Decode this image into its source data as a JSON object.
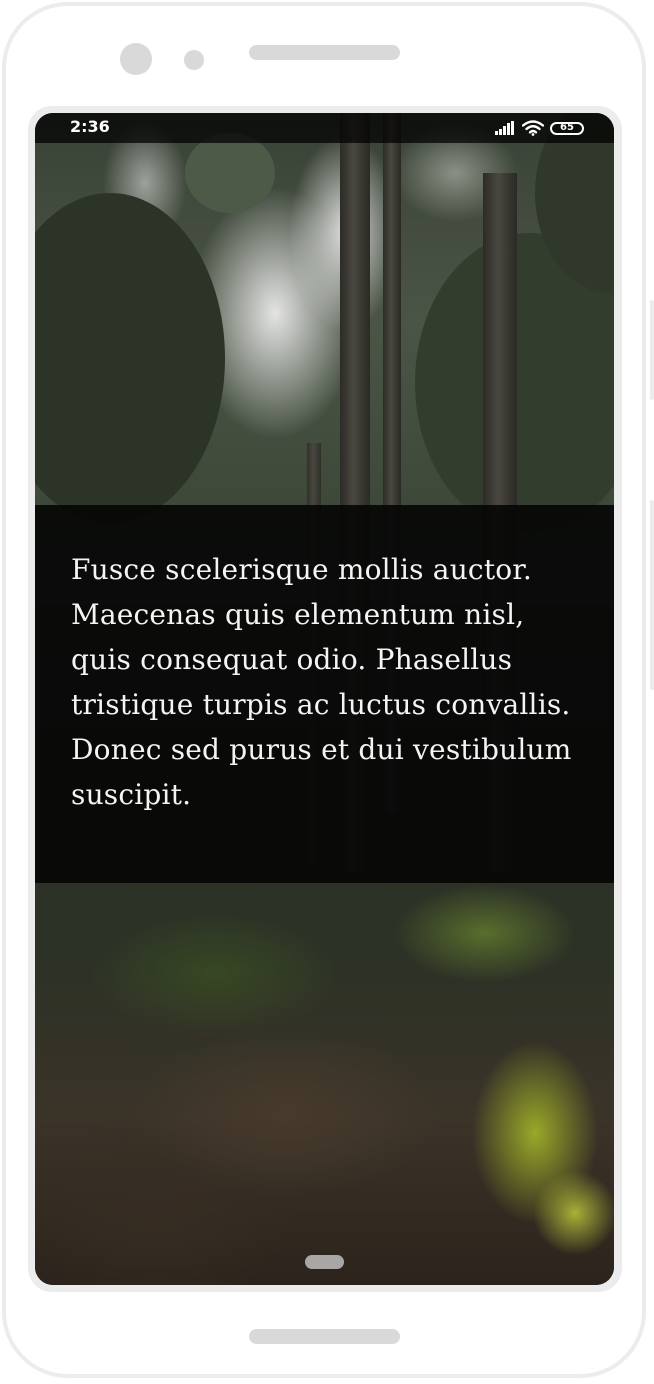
{
  "status_bar": {
    "time": "2:36",
    "battery_level": "65",
    "icons": [
      "signal-icon",
      "wifi-icon",
      "battery-icon"
    ]
  },
  "content": {
    "paragraph": "Fusce scelerisque mollis auctor. Maecenas quis elementum nisl, quis consequat odio. Phasellus tristique turpis ac luctus convallis. Donec sed purus et dui vestibulum suscipit."
  },
  "background": {
    "subject": "forest-path-image"
  },
  "colors": {
    "overlay": "#050505",
    "text": "#f4f4f4",
    "device_frame": "#ececec"
  }
}
